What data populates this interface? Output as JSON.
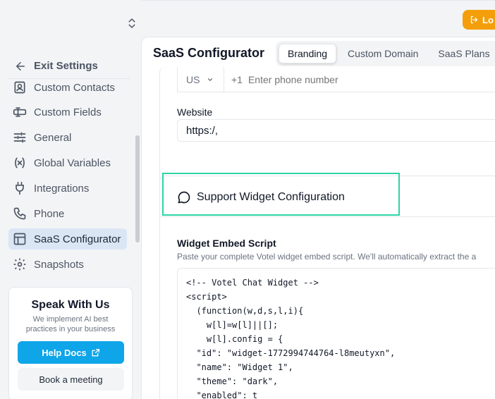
{
  "sidebar": {
    "exit_label": "Exit Settings",
    "items": [
      {
        "label": "Custom Contacts",
        "icon": "contacts-icon"
      },
      {
        "label": "Custom Fields",
        "icon": "fields-icon"
      },
      {
        "label": "General",
        "icon": "sliders-icon"
      },
      {
        "label": "Global Variables",
        "icon": "variable-icon"
      },
      {
        "label": "Integrations",
        "icon": "plug-icon"
      },
      {
        "label": "Phone",
        "icon": "phone-icon"
      },
      {
        "label": "SaaS Configurator",
        "icon": "layout-icon",
        "active": true
      },
      {
        "label": "Snapshots",
        "icon": "gear-icon"
      }
    ],
    "speak": {
      "title": "Speak With Us",
      "subtitle": "We implement AI best practices in your business",
      "docs_label": "Help Docs",
      "book_label": "Book a meeting"
    }
  },
  "topbar": {
    "logout_label": "Lo"
  },
  "main": {
    "title": "SaaS Configurator",
    "tabs": [
      {
        "label": "Branding",
        "active": true
      },
      {
        "label": "Custom Domain"
      },
      {
        "label": "SaaS Plans"
      }
    ],
    "phone": {
      "country": "US",
      "prefix": "+1",
      "placeholder": "Enter phone number"
    },
    "website": {
      "label": "Website",
      "value": "https:/,"
    },
    "support_widget": {
      "title": "Support Widget Configuration",
      "embed_label": "Widget Embed Script",
      "embed_help": "Paste your complete Votel widget embed script. We'll automatically extract the a",
      "code": "<!-- Votel Chat Widget -->\n<script>\n  (function(w,d,s,l,i){\n    w[l]=w[l]||[];\n    w[l].config = {\n  \"id\": \"widget-1772994744764-l8meutyxn\",\n  \"name\": \"Widget 1\",\n  \"theme\": \"dark\",\n  \"enabled\": t"
    }
  },
  "colors": {
    "accent": "#0ea5e9",
    "logout": "#f59e0b",
    "highlight": "#2dd4a7",
    "active_nav": "#dbe6f5"
  }
}
